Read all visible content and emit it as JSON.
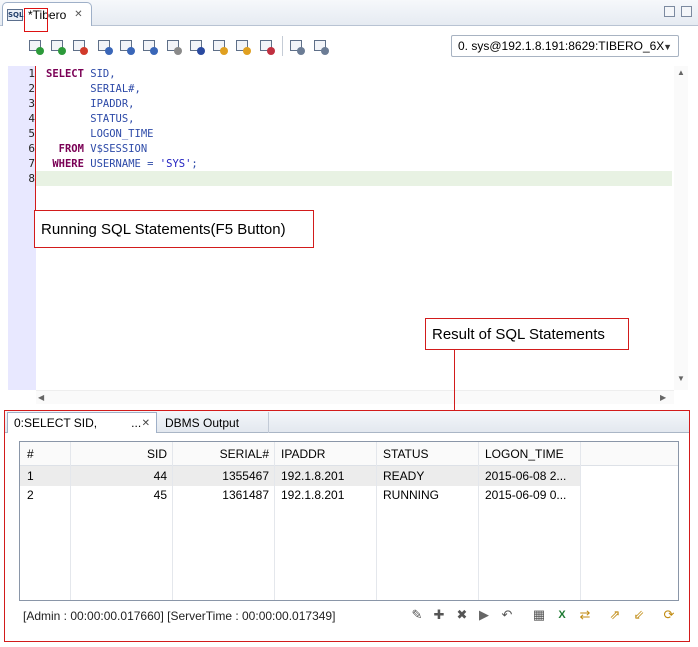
{
  "editor_tab": {
    "title": "*Tibero",
    "close": "✕"
  },
  "toolbar": {
    "connection": "0. sys@192.1.8.191:8629:TIBERO_6X",
    "buttons": [
      {
        "name": "run-sql-icon",
        "color": "#2c9a3a"
      },
      {
        "name": "run-script-icon",
        "color": "#2c9a3a"
      },
      {
        "name": "run-current-icon",
        "color": "#d13a2a"
      },
      {
        "name": "explain-plan-icon",
        "color": "#3a66b8"
      },
      {
        "name": "format-sql-icon",
        "color": "#3a66b8"
      },
      {
        "name": "comment-icon",
        "color": "#3a66b8"
      },
      {
        "name": "document-icon",
        "color": "#8a8a8a"
      },
      {
        "name": "sql-file-icon",
        "color": "#2a4aa0"
      },
      {
        "name": "commit-icon",
        "color": "#e0a020"
      },
      {
        "name": "rollback-icon",
        "color": "#e0a020"
      },
      {
        "name": "history-icon",
        "color": "#c03040"
      },
      {
        "name": "window-split-icon",
        "color": "#6b7c95"
      },
      {
        "name": "window-restore-icon",
        "color": "#6b7c95"
      }
    ]
  },
  "code": {
    "lines": [
      "1",
      "2",
      "3",
      "4",
      "5",
      "6",
      "7",
      "8"
    ],
    "l1_kw": "SELECT",
    "l1_rest": " SID,",
    "l2": "       SERIAL#,",
    "l3": "       IPADDR,",
    "l4": "       STATUS,",
    "l5": "       LOGON_TIME",
    "l6_kw": "  FROM",
    "l6_rest": " V$SESSION",
    "l7_kw": " WHERE",
    "l7_mid": " USERNAME = ",
    "l7_str": "'SYS'",
    "l7_end": ";"
  },
  "callouts": {
    "run": "Running SQL Statements(F5 Button)",
    "result": "Result of SQL Statements"
  },
  "result": {
    "tab_active": "0:SELECT SID,",
    "tab_dots": "...",
    "tab_close": "✕",
    "tab_other": "DBMS Output",
    "columns": [
      "#",
      "SID",
      "SERIAL#",
      "IPADDR",
      "STATUS",
      "LOGON_TIME"
    ],
    "rows": [
      [
        "1",
        "44",
        "1355467",
        "192.1.8.201",
        "READY",
        "2015-06-08 2..."
      ],
      [
        "2",
        "45",
        "1361487",
        "192.1.8.201",
        "RUNNING",
        "2015-06-09 0..."
      ]
    ],
    "status": "[Admin : 00:00:00.017660] [ServerTime : 00:00:00.017349]",
    "tools": [
      {
        "name": "edit-icon",
        "glyph": "✎"
      },
      {
        "name": "add-row-icon",
        "glyph": "✚"
      },
      {
        "name": "delete-row-icon",
        "glyph": "✖"
      },
      {
        "name": "apply-icon",
        "glyph": "▶"
      },
      {
        "name": "revert-icon",
        "glyph": "↶"
      },
      {
        "name": "table-view-icon",
        "glyph": "▦"
      },
      {
        "name": "export-excel-icon",
        "glyph": "X"
      },
      {
        "name": "transpose-icon",
        "glyph": "⇄"
      },
      {
        "name": "export-icon",
        "glyph": "⇗"
      },
      {
        "name": "import-icon",
        "glyph": "⇙"
      },
      {
        "name": "refresh-icon",
        "glyph": "⟳"
      }
    ]
  }
}
